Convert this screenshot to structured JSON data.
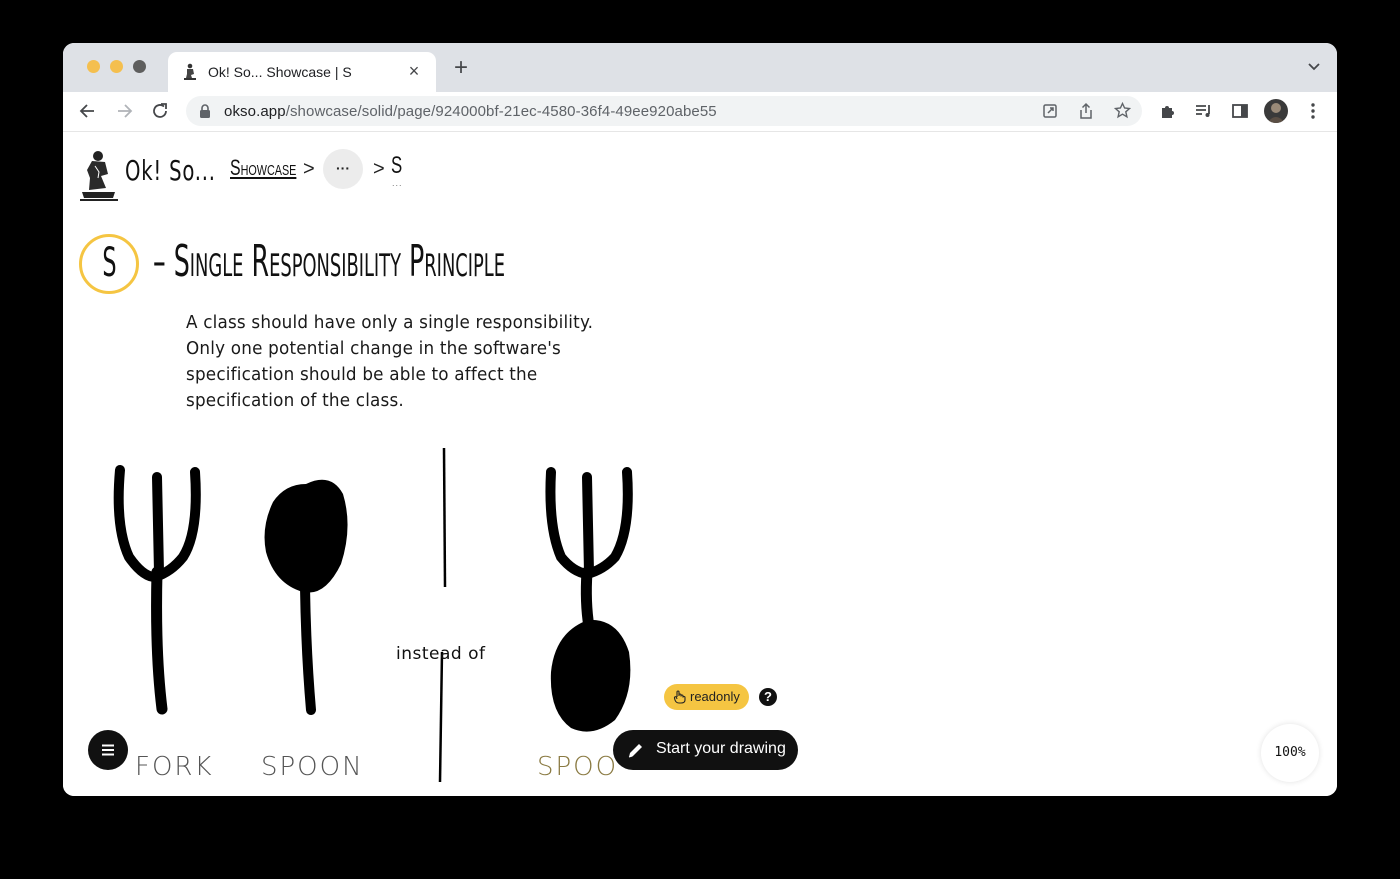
{
  "browser": {
    "tab_title": "Ok! So... Showcase | S",
    "tab_close": "×",
    "new_tab": "+",
    "url_host": "okso.app",
    "url_path": "/showcase/solid/page/924000bf-21ec-4580-36f4-49ee920abe55"
  },
  "header": {
    "app_name": "Ok! So...",
    "breadcrumb": {
      "showcase": "Showcase",
      "separator": ">",
      "more": "···",
      "current": "S",
      "current_sub": "..."
    }
  },
  "content": {
    "badge_letter": "S",
    "title": "– Single Responsibility Principle",
    "description_lines": [
      "A class should have only a single responsibility.",
      "Only one potential change in the software's",
      "specification should be able to affect the",
      "specification of the class."
    ],
    "drawing": {
      "fork_label": "FORK",
      "spoon_label": "SPOON",
      "spork_label": "SPOON",
      "instead_of": "instead of"
    }
  },
  "controls": {
    "readonly_label": "readonly",
    "help_label": "?",
    "start_drawing_label": "Start your drawing",
    "zoom_level": "100%"
  },
  "colors": {
    "accent": "#f5c542",
    "ink": "#111111"
  }
}
